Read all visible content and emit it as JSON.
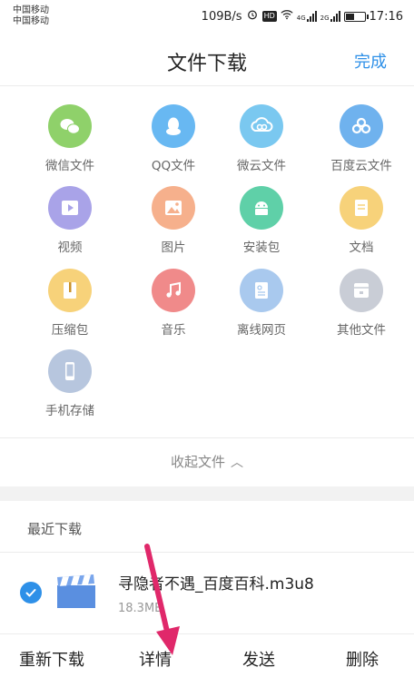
{
  "status_bar": {
    "carrier_1": "中国移动",
    "carrier_2": "中国移动",
    "speed": "109B/s",
    "hd": "HD",
    "net_1": "4G",
    "net_2": "2G",
    "time": "17:16",
    "battery_level": 0.45
  },
  "header": {
    "title": "文件下载",
    "done_label": "完成"
  },
  "categories": [
    {
      "label": "微信文件",
      "icon": "wechat-icon",
      "color": "#8fd16a"
    },
    {
      "label": "QQ文件",
      "icon": "qq-icon",
      "color": "#68b8f2"
    },
    {
      "label": "微云文件",
      "icon": "weiyun-icon",
      "color": "#7ac8f0"
    },
    {
      "label": "百度云文件",
      "icon": "baidu-cloud-icon",
      "color": "#6fb2ee"
    },
    {
      "label": "视频",
      "icon": "video-icon",
      "color": "#a9a3e8"
    },
    {
      "label": "图片",
      "icon": "image-icon",
      "color": "#f6b08c"
    },
    {
      "label": "安装包",
      "icon": "android-icon",
      "color": "#5fd0a8"
    },
    {
      "label": "文档",
      "icon": "document-icon",
      "color": "#f7d27a"
    },
    {
      "label": "压缩包",
      "icon": "archive-icon",
      "color": "#f7d27a"
    },
    {
      "label": "音乐",
      "icon": "music-icon",
      "color": "#f08a8a"
    },
    {
      "label": "离线网页",
      "icon": "offline-web-icon",
      "color": "#a9c9ee"
    },
    {
      "label": "其他文件",
      "icon": "other-file-icon",
      "color": "#c9cdd6"
    },
    {
      "label": "手机存储",
      "icon": "phone-storage-icon",
      "color": "#b7c6de"
    }
  ],
  "collapse_label": "收起文件",
  "recent": {
    "title": "最近下载",
    "file_name": "寻隐者不遇_百度百科.m3u8",
    "file_size": "18.3MB"
  },
  "actions": {
    "redownload": "重新下载",
    "details": "详情",
    "send": "发送",
    "delete": "删除"
  },
  "colors": {
    "accent": "#2e90e8",
    "annotation_arrow": "#e0286a"
  }
}
